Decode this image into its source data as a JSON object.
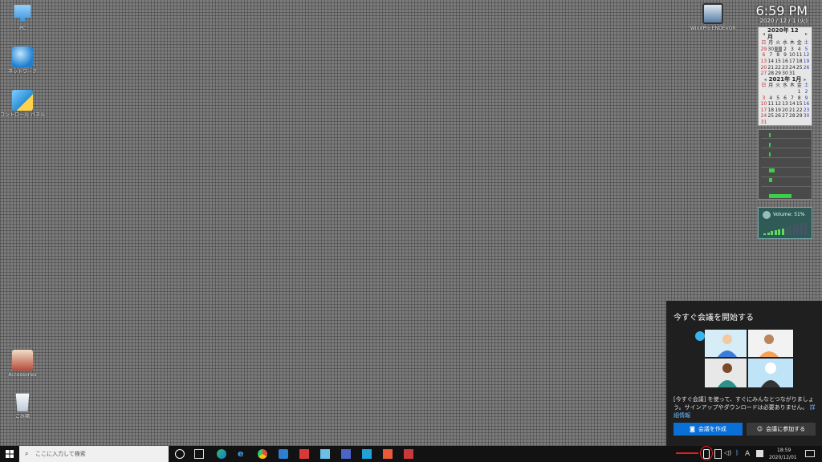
{
  "desktop": {
    "icons": [
      {
        "label": "PC",
        "glyph": "pc-icon"
      },
      {
        "label": "ネットワーク",
        "glyph": "network-icon"
      },
      {
        "label": "コントロール パネル",
        "glyph": "control-panel-icon"
      },
      {
        "label": "Accessories",
        "glyph": "accessories-icon"
      },
      {
        "label": "ごみ箱",
        "glyph": "recycle-bin-icon"
      },
      {
        "label": "WinXPro ENDEVOR64",
        "glyph": "monitor-icon"
      }
    ]
  },
  "clock": {
    "time": "6:59 PM",
    "date": "2020 / 12 / 1 (火)"
  },
  "calendar": {
    "months": [
      {
        "title": "2020年 12月",
        "weekdays": [
          "日",
          "月",
          "火",
          "水",
          "木",
          "金",
          "土"
        ],
        "weeks": [
          [
            "29",
            "30",
            "1",
            "2",
            "3",
            "4",
            "5"
          ],
          [
            "6",
            "7",
            "8",
            "9",
            "10",
            "11",
            "12"
          ],
          [
            "13",
            "14",
            "15",
            "16",
            "17",
            "18",
            "19"
          ],
          [
            "20",
            "21",
            "22",
            "23",
            "24",
            "25",
            "26"
          ],
          [
            "27",
            "28",
            "29",
            "30",
            "31",
            "",
            ""
          ]
        ]
      },
      {
        "title": "2021年 1月",
        "weekdays": [
          "日",
          "月",
          "火",
          "水",
          "木",
          "金",
          "土"
        ],
        "weeks": [
          [
            "",
            "",
            "",
            "",
            "",
            "1",
            "2"
          ],
          [
            "3",
            "4",
            "5",
            "6",
            "7",
            "8",
            "9"
          ],
          [
            "10",
            "11",
            "12",
            "13",
            "14",
            "15",
            "16"
          ],
          [
            "17",
            "18",
            "19",
            "20",
            "21",
            "22",
            "23"
          ],
          [
            "24",
            "25",
            "26",
            "27",
            "28",
            "29",
            "30"
          ],
          [
            "31",
            "",
            "",
            "",
            "",
            "",
            ""
          ]
        ]
      }
    ]
  },
  "volume_gadget": {
    "label": "Volume: 51%",
    "level": 0.51
  },
  "meet_now": {
    "title": "今すぐ会議を開始する",
    "description": "[今すぐ会議] を使って、すぐにみんなとつながりましょう。サインアップやダウンロードは必要ありません。",
    "link": "詳細情報",
    "create_button": "会議を作成",
    "join_button": "会議に参加する"
  },
  "taskbar": {
    "search_placeholder": "ここに入力して検索",
    "tray_time": "18:59",
    "tray_date": "2020/12/01",
    "ime_label": "A"
  },
  "colors": {
    "accent": "#0a6fd6",
    "annotation": "#e02020"
  }
}
